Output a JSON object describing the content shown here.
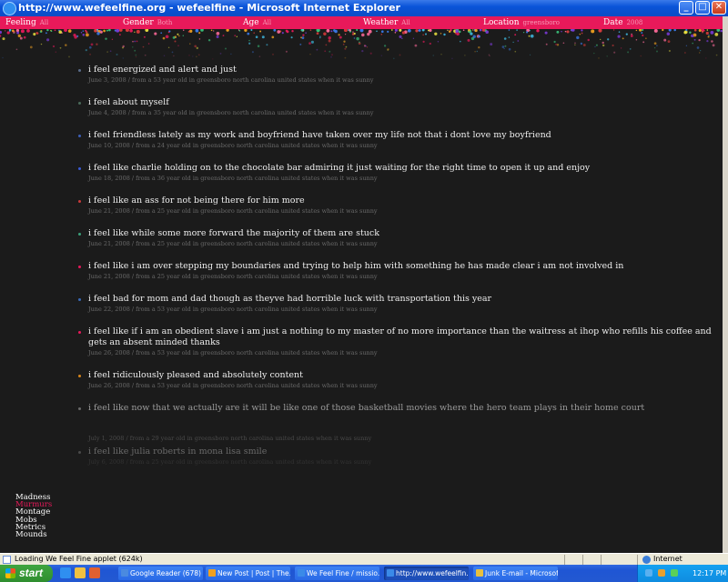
{
  "window": {
    "title": "http://www.wefeelfine.org - wefeelfine - Microsoft Internet Explorer"
  },
  "filters": [
    {
      "label": "Feeling",
      "value": "All"
    },
    {
      "label": "Gender",
      "value": "Both"
    },
    {
      "label": "Age",
      "value": "All"
    },
    {
      "label": "Weather",
      "value": "All"
    },
    {
      "label": "Location",
      "value": "greensboro"
    },
    {
      "label": "Date",
      "value": "2008"
    }
  ],
  "feelings": [
    {
      "text": "i feel energized and alert and just",
      "meta": "June 3, 2008 / from a 53 year old in greensboro north carolina united states when it was sunny",
      "color": "#5a6b8a"
    },
    {
      "text": "i feel about myself",
      "meta": "June 4, 2008 / from a 35 year old in greensboro north carolina united states when it was sunny",
      "color": "#4a6a5a"
    },
    {
      "text": "i feel friendless lately as my work and boyfriend have taken over my life not that i dont love my boyfriend",
      "meta": "June 10, 2008 / from a 24 year old in greensboro north carolina united states when it was sunny",
      "color": "#3d5fb8"
    },
    {
      "text": "i feel like charlie holding on to the chocolate bar admiring it just waiting for the right time to open it up and enjoy",
      "meta": "June 18, 2008 / from a 36 year old in greensboro north carolina united states when it was sunny",
      "color": "#3a5ad6"
    },
    {
      "text": "i feel like an ass for not being there for him more",
      "meta": "June 21, 2008 / from a 25 year old in greensboro north carolina united states when it was sunny",
      "color": "#c83a3a"
    },
    {
      "text": "i feel like while some more forward the majority of them are stuck",
      "meta": "June 21, 2008 / from a 25 year old in greensboro north carolina united states when it was sunny",
      "color": "#3aa07a"
    },
    {
      "text": "i feel like i am over stepping my boundaries and trying to help him with something he has made clear i am not involved in",
      "meta": "June 21, 2008 / from a 25 year old in greensboro north carolina united states when it was sunny",
      "color": "#e8195a"
    },
    {
      "text": "i feel bad for mom and dad though as theyve had horrible luck with transportation this year",
      "meta": "June 22, 2008 / from a 53 year old in greensboro north carolina united states when it was sunny",
      "color": "#3a6ab8"
    },
    {
      "text": "i feel like if i am an obedient slave i am just a nothing to my master of no more importance than the waitress at ihop who refills his coffee and gets an absent minded thanks",
      "meta": "June 26, 2008 / from a 53 year old in greensboro north carolina united states when it was sunny",
      "color": "#e8195a"
    },
    {
      "text": "i feel ridiculously pleased and absolutely content",
      "meta": "June 26, 2008 / from a 53 year old in greensboro north carolina united states when it was sunny",
      "color": "#d8861a"
    },
    {
      "text": "i feel like now that we actually are it will be like one of those basketball movies where the hero team plays in their home court",
      "meta": "July 1, 2008 / from a 29 year old in greensboro north carolina united states when it was sunny",
      "color": "#6a6a6a"
    },
    {
      "text": "i feel like julia roberts in mona lisa smile",
      "meta": "July 6, 2008 / from a 25 year old in greensboro north carolina united states when it was sunny",
      "color": "#4a4a4a"
    }
  ],
  "nav": {
    "items": [
      "Madness",
      "Murmurs",
      "Montage",
      "Mobs",
      "Metrics",
      "Mounds"
    ],
    "active": "Murmurs"
  },
  "statusbar": {
    "message": "Loading We Feel Fine applet (624k)",
    "zone": "Internet"
  },
  "taskbar": {
    "start": "start",
    "tasks": [
      {
        "label": "Google Reader (678) ...",
        "color": "#4a8ae0"
      },
      {
        "label": "New Post | Post | The...",
        "color": "#f0a020"
      },
      {
        "label": "We Feel Fine / missio...",
        "color": "#3a8ae8"
      },
      {
        "label": "http://www.wefeelfin...",
        "color": "#3a8ae8",
        "active": true
      },
      {
        "label": "Junk E-mail - Microsof...",
        "color": "#e8c040"
      }
    ],
    "clock": "12:17 PM"
  }
}
